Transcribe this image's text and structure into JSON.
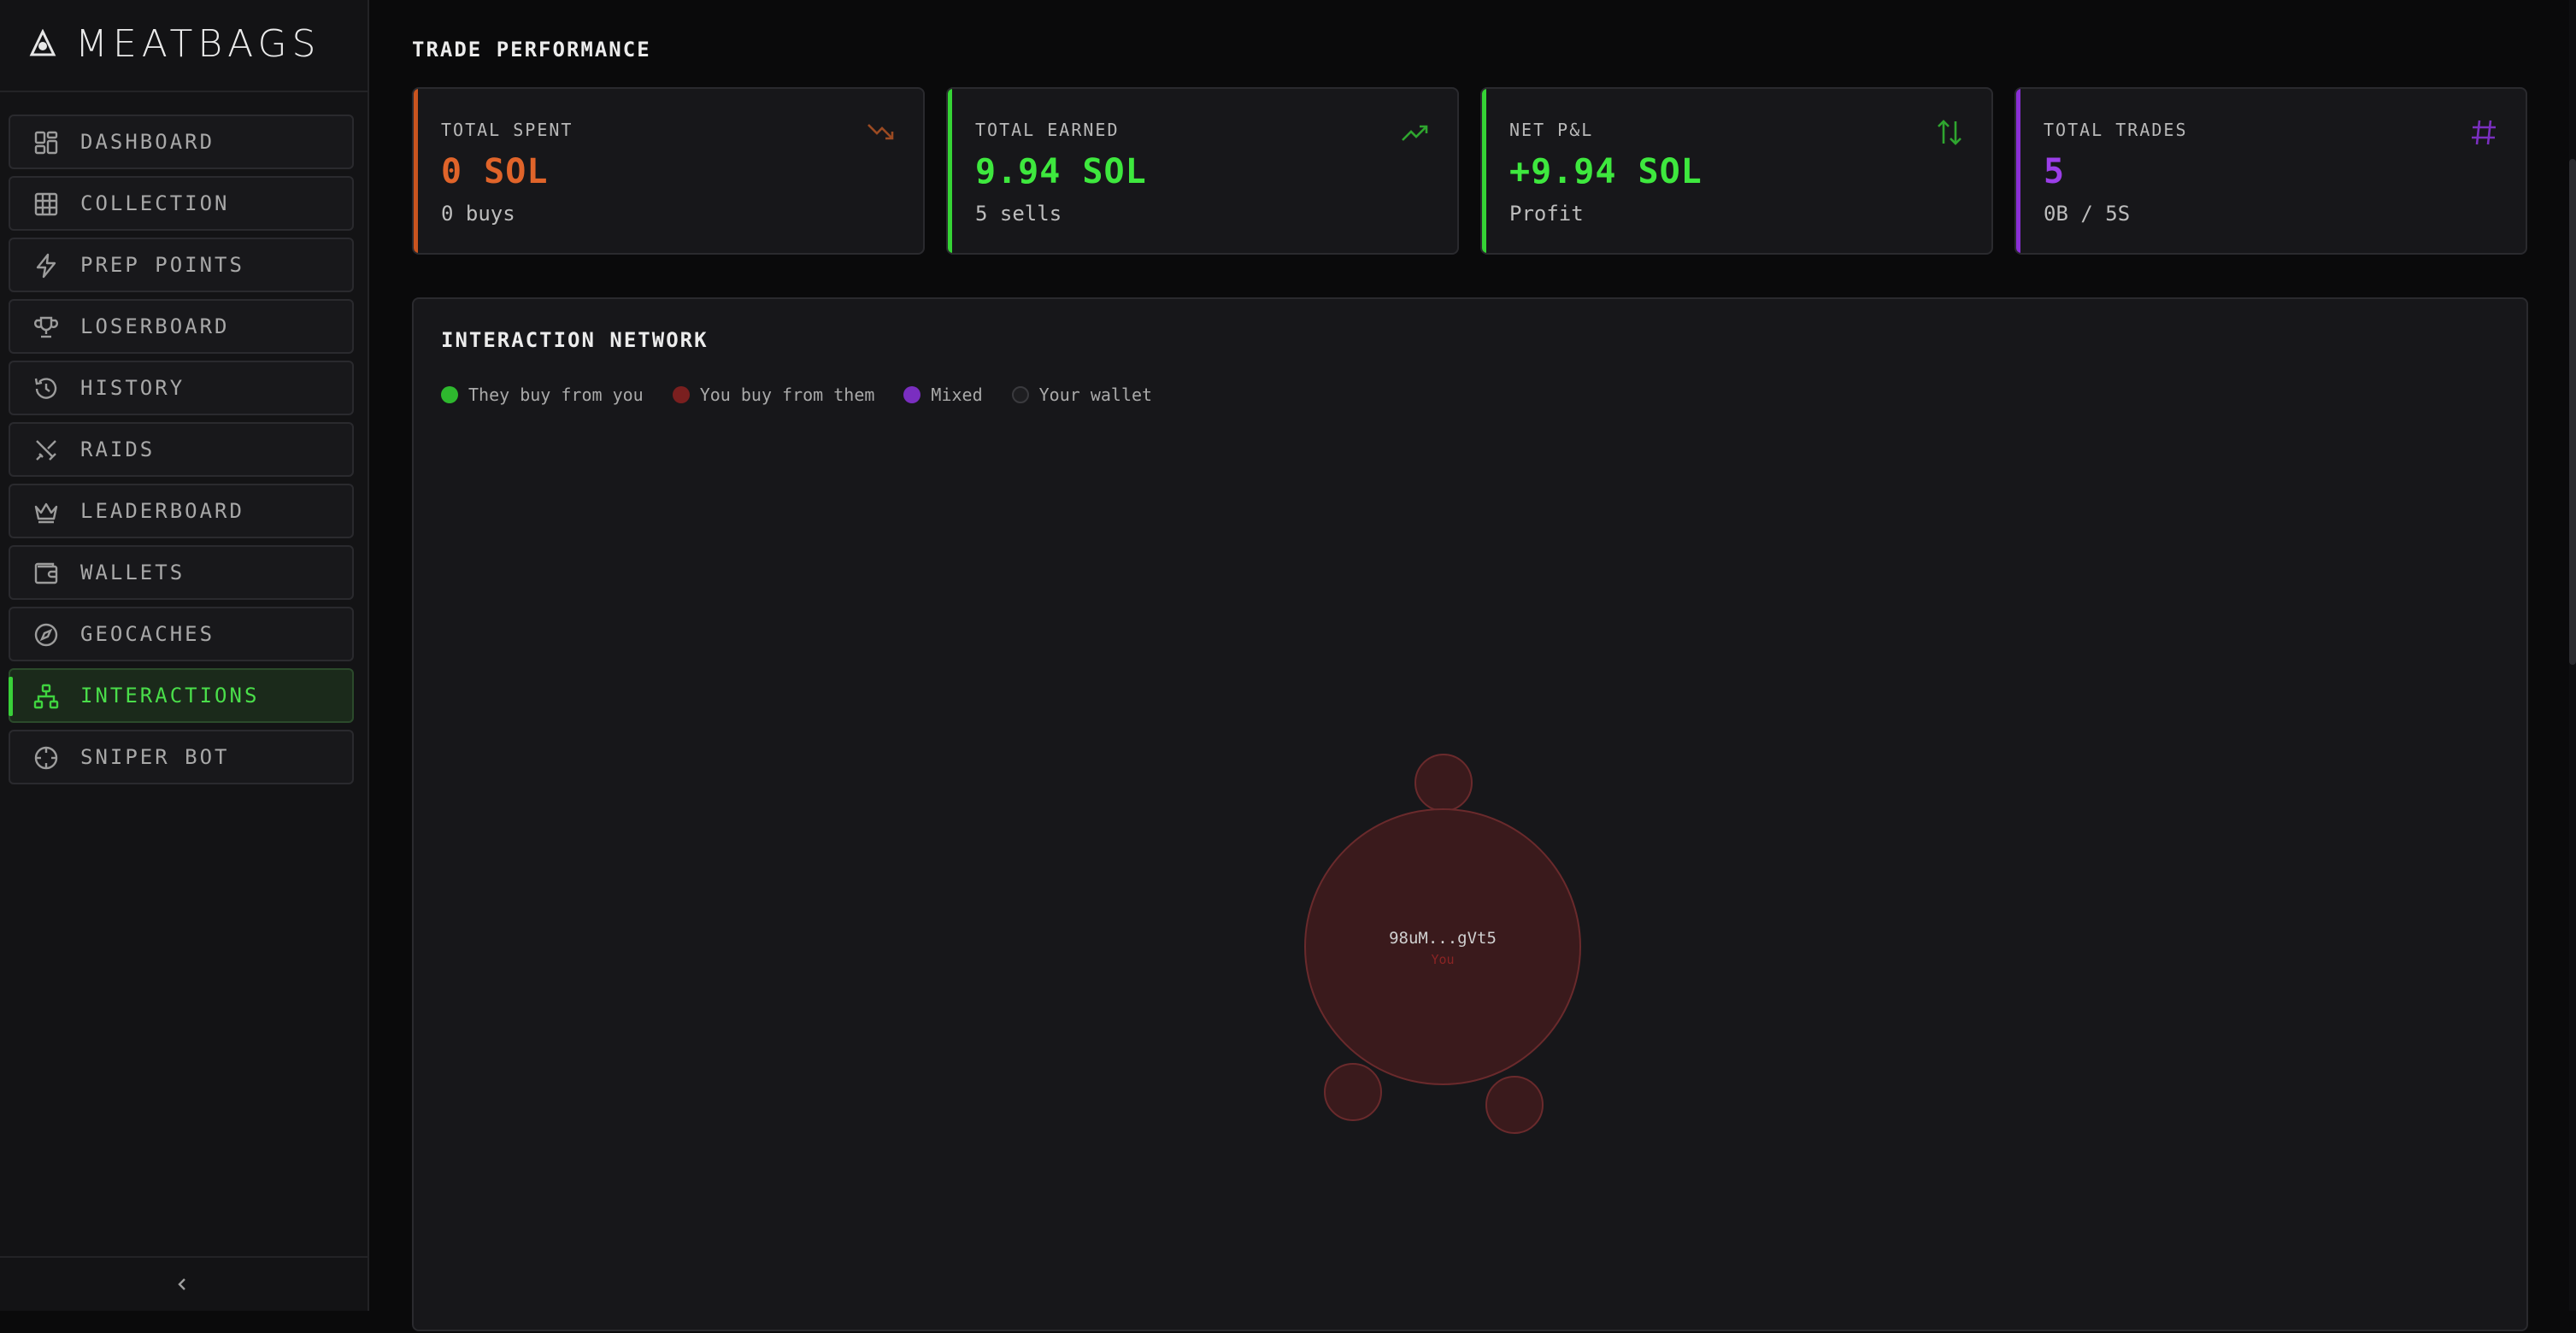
{
  "app": {
    "brand": "MEATBAGS"
  },
  "sidebar": {
    "items": [
      {
        "label": "DASHBOARD",
        "icon": "dashboard-icon"
      },
      {
        "label": "COLLECTION",
        "icon": "grid-icon"
      },
      {
        "label": "PREP POINTS",
        "icon": "lightning-icon"
      },
      {
        "label": "LOSERBOARD",
        "icon": "trophy-icon"
      },
      {
        "label": "HISTORY",
        "icon": "history-icon"
      },
      {
        "label": "RAIDS",
        "icon": "swords-icon"
      },
      {
        "label": "LEADERBOARD",
        "icon": "crown-icon"
      },
      {
        "label": "WALLETS",
        "icon": "wallet-icon"
      },
      {
        "label": "GEOCACHES",
        "icon": "compass-icon"
      },
      {
        "label": "INTERACTIONS",
        "icon": "network-icon",
        "active": true
      },
      {
        "label": "SNIPER BOT",
        "icon": "crosshair-icon"
      }
    ],
    "collapse_icon": "chevron-left-icon"
  },
  "trade_performance": {
    "title": "TRADE PERFORMANCE",
    "cards": [
      {
        "label": "TOTAL SPENT",
        "value": "0 SOL",
        "sub": "0 buys",
        "color": "#e0642a",
        "icon": "trending-down-icon"
      },
      {
        "label": "TOTAL EARNED",
        "value": "9.94 SOL",
        "sub": "5 sells",
        "color": "#3ee83e",
        "icon": "trending-up-icon"
      },
      {
        "label": "NET P&L",
        "value": "+9.94 SOL",
        "sub": "Profit",
        "color": "#3ee83e",
        "icon": "arrows-up-down-icon"
      },
      {
        "label": "TOTAL TRADES",
        "value": "5",
        "sub": "0B / 5S",
        "color": "#9b3ee8",
        "icon": "hash-icon"
      }
    ]
  },
  "network": {
    "title": "INTERACTION NETWORK",
    "legend": [
      {
        "label": "They buy from you",
        "color": "#2eb82e"
      },
      {
        "label": "You buy from them",
        "color": "#7a1f1f"
      },
      {
        "label": "Mixed",
        "color": "#7a2ec0"
      },
      {
        "label": "Your wallet",
        "color": "#1e1e21"
      }
    ],
    "center_node": {
      "label": "98uM...gVt5",
      "sublabel": "You"
    }
  },
  "colors": {
    "accent_green": "#39d139",
    "node_fill": "#3a1a1c",
    "node_stroke": "#6a2a2c"
  }
}
